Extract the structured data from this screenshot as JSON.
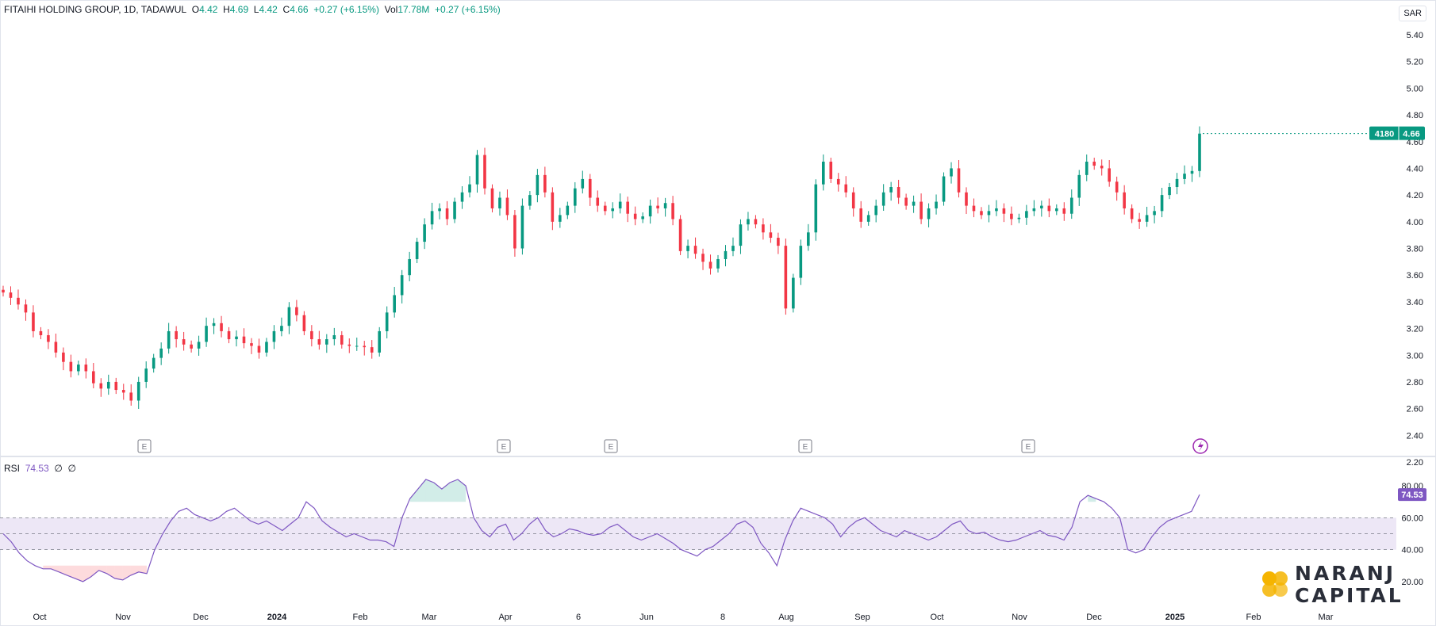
{
  "header": {
    "symbol": "FITAIHI HOLDING GROUP, 1D, TADAWUL",
    "open_label": "O",
    "open": "4.42",
    "high_label": "H",
    "high": "4.69",
    "low_label": "L",
    "low": "4.42",
    "close_label": "C",
    "close": "4.66",
    "change": "+0.27 (+6.15%)",
    "vol_label": "Vol",
    "vol": "17.78M",
    "vol_change": "+0.27 (+6.15%)"
  },
  "currency": "SAR",
  "price_badge": {
    "countdown": "4180",
    "price": "4.66"
  },
  "rsi": {
    "label": "RSI",
    "value": "74.53",
    "p1": "∅",
    "p2": "∅",
    "badge": "74.53"
  },
  "logo": {
    "line1": "NARANJ",
    "line2": "CAPITAL"
  },
  "colors": {
    "up": "#089981",
    "down": "#f23645",
    "rsi": "#7e57c2",
    "band": "#ede7f6",
    "logo": "#f5b400"
  },
  "chart_data": [
    {
      "type": "candlestick",
      "x_ticks": [
        "Oct",
        "Nov",
        "Dec",
        "2024",
        "Feb",
        "Mar",
        "Apr",
        "6",
        "Jun",
        "8",
        "Aug",
        "Sep",
        "Oct",
        "Nov",
        "Dec",
        "2025",
        "Feb",
        "Mar"
      ],
      "y_ticks": [
        "5.40",
        "5.20",
        "5.00",
        "4.80",
        "4.60",
        "4.40",
        "4.20",
        "4.00",
        "3.80",
        "3.60",
        "3.40",
        "3.20",
        "3.00",
        "2.80",
        "2.60",
        "2.40",
        "2.20"
      ],
      "ylim": [
        2.2,
        5.4
      ],
      "earnings_markers": [
        "E",
        "E",
        "E",
        "E",
        "E"
      ],
      "close_series": [
        3.47,
        3.43,
        3.38,
        3.32,
        3.18,
        3.15,
        3.1,
        3.02,
        2.95,
        2.88,
        2.93,
        2.88,
        2.79,
        2.75,
        2.8,
        2.74,
        2.72,
        2.66,
        2.8,
        2.9,
        2.98,
        3.05,
        3.18,
        3.12,
        3.08,
        3.05,
        3.1,
        3.22,
        3.24,
        3.18,
        3.12,
        3.14,
        3.09,
        3.07,
        3.02,
        3.1,
        3.18,
        3.22,
        3.36,
        3.3,
        3.18,
        3.12,
        3.08,
        3.12,
        3.15,
        3.08,
        3.07,
        3.07,
        3.06,
        3.02,
        3.18,
        3.32,
        3.45,
        3.6,
        3.72,
        3.85,
        3.98,
        4.08,
        4.1,
        4.02,
        4.15,
        4.22,
        4.28,
        4.5,
        4.25,
        4.1,
        4.18,
        4.05,
        3.8,
        4.12,
        4.2,
        4.35,
        4.22,
        4.0,
        4.05,
        4.12,
        4.25,
        4.32,
        4.18,
        4.12,
        4.08,
        4.1,
        4.15,
        4.06,
        4.02,
        4.04,
        4.12,
        4.1,
        4.14,
        4.02,
        3.78,
        3.82,
        3.76,
        3.7,
        3.65,
        3.72,
        3.78,
        3.82,
        3.98,
        4.02,
        3.98,
        3.92,
        3.88,
        3.82,
        3.35,
        3.58,
        3.82,
        3.92,
        4.28,
        4.45,
        4.32,
        4.28,
        4.22,
        4.1,
        4.0,
        4.05,
        4.12,
        4.22,
        4.26,
        4.18,
        4.12,
        4.15,
        4.02,
        4.1,
        4.15,
        4.34,
        4.4,
        4.22,
        4.12,
        4.08,
        4.05,
        4.08,
        4.1,
        4.06,
        4.02,
        4.03,
        4.08,
        4.1,
        4.12,
        4.08,
        4.1,
        4.06,
        4.18,
        4.35,
        4.45,
        4.42,
        4.4,
        4.3,
        4.22,
        4.1,
        4.02,
        4.0,
        4.05,
        4.08,
        4.2,
        4.26,
        4.32,
        4.36,
        4.38,
        4.66
      ]
    },
    {
      "type": "line",
      "name": "RSI",
      "y_ticks": [
        "80.00",
        "60.00",
        "40.00",
        "20.00"
      ],
      "ylim": [
        14,
        84
      ],
      "bands": [
        40,
        50,
        60
      ],
      "values": [
        50,
        45,
        38,
        33,
        30,
        28,
        28,
        26,
        24,
        22,
        20,
        23,
        27,
        25,
        22,
        21,
        24,
        26,
        25,
        40,
        50,
        58,
        64,
        66,
        62,
        60,
        58,
        60,
        64,
        66,
        62,
        58,
        56,
        58,
        55,
        52,
        56,
        60,
        70,
        66,
        58,
        54,
        51,
        48,
        50,
        48,
        46,
        46,
        45,
        42,
        60,
        72,
        78,
        84,
        82,
        78,
        82,
        84,
        80,
        60,
        52,
        48,
        54,
        56,
        46,
        50,
        56,
        60,
        52,
        48,
        50,
        53,
        52,
        50,
        49,
        50,
        54,
        56,
        52,
        48,
        46,
        48,
        50,
        47,
        44,
        40,
        38,
        36,
        40,
        42,
        46,
        50,
        56,
        58,
        54,
        44,
        38,
        30,
        46,
        58,
        66,
        64,
        62,
        60,
        56,
        48,
        54,
        58,
        60,
        56,
        52,
        50,
        48,
        52,
        50,
        48,
        46,
        48,
        52,
        56,
        58,
        52,
        50,
        51,
        48,
        46,
        45,
        46,
        48,
        50,
        52,
        49,
        48,
        46,
        54,
        70,
        74,
        72,
        70,
        66,
        60,
        40,
        38,
        40,
        48,
        54,
        58,
        60,
        62,
        64,
        74.53
      ]
    }
  ]
}
